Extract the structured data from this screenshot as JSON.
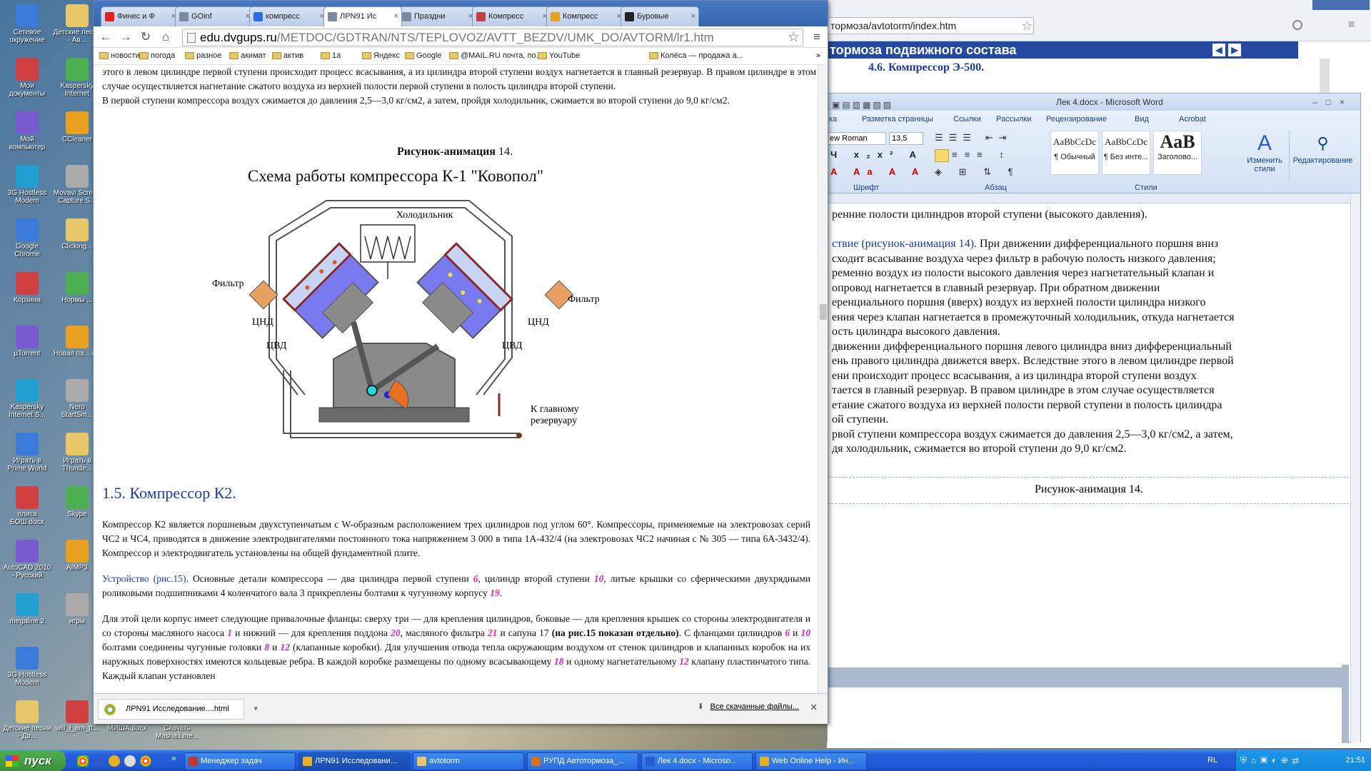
{
  "desktop": {
    "icons": [
      {
        "label": "Сетевое окружение",
        "col": 0,
        "row": 0
      },
      {
        "label": "Детские песни - Ав...",
        "col": 1,
        "row": 0
      },
      {
        "label": "Мои документы",
        "col": 0,
        "row": 1
      },
      {
        "label": "Kaspersky Internet",
        "col": 1,
        "row": 1
      },
      {
        "label": "Мой компьютер",
        "col": 0,
        "row": 2
      },
      {
        "label": "CCleaner",
        "col": 1,
        "row": 2
      },
      {
        "label": "3G Hostless Modem",
        "col": 0,
        "row": 3
      },
      {
        "label": "Movavi Screen Capture S...",
        "col": 1,
        "row": 3
      },
      {
        "label": "Google Chrome",
        "col": 0,
        "row": 4
      },
      {
        "label": "Clicking...",
        "col": 1,
        "row": 4
      },
      {
        "label": "Корзина",
        "col": 0,
        "row": 5
      },
      {
        "label": "Нормы ...",
        "col": 1,
        "row": 5
      },
      {
        "label": "µTorrent",
        "col": 0,
        "row": 6
      },
      {
        "label": "Новая па... (2)",
        "col": 1,
        "row": 6
      },
      {
        "label": "Kaspersky Internet S...",
        "col": 0,
        "row": 7
      },
      {
        "label": "Nero StartSm...",
        "col": 1,
        "row": 7
      },
      {
        "label": "Играть в Prime World",
        "col": 0,
        "row": 8
      },
      {
        "label": "Играть в Thunde...",
        "col": 1,
        "row": 8
      },
      {
        "label": "плита БОШ.docx",
        "col": 0,
        "row": 9
      },
      {
        "label": "Skype",
        "col": 1,
        "row": 9
      },
      {
        "label": "AutoCAD 2010 - Русский",
        "col": 0,
        "row": 10
      },
      {
        "label": "AIMP3",
        "col": 1,
        "row": 10
      },
      {
        "label": "megaline 2",
        "col": 0,
        "row": 11
      },
      {
        "label": "игры",
        "col": 1,
        "row": 11
      },
      {
        "label": "3G Hostless Modem",
        "col": 0,
        "row": 12
      },
      {
        "label": "Детские песни - Дв...",
        "col": 0,
        "row": 13
      },
      {
        "label": "will_i_am_ft...",
        "col": 1,
        "row": 13
      },
      {
        "label": "МИША.docx",
        "col": 2,
        "row": 13
      },
      {
        "label": "Скачать Masha.i.me...",
        "col": 3,
        "row": 13
      }
    ]
  },
  "browser": {
    "tabs": [
      {
        "label": "Финес и Ф",
        "color": "#e02020"
      },
      {
        "label": "GOinf",
        "color": "#7a8aa0"
      },
      {
        "label": "компресс",
        "color": "#2a6de0"
      },
      {
        "label": "ЛРN91 Ис",
        "color": "#7a8aa0",
        "active": true
      },
      {
        "label": "Праздни",
        "color": "#7a8aa0"
      },
      {
        "label": "Компресс",
        "color": "#c04040"
      },
      {
        "label": "Компресс",
        "color": "#e8a020"
      },
      {
        "label": "Буровые",
        "color": "#222222"
      }
    ],
    "url_host": "edu.dvgups.ru",
    "url_path": "/METDOC/GDTRAN/NTS/TEPLOVOZ/AVTT_BEZDV/UMK_DO/AVTORM/lr1.htm",
    "bookmarks": [
      "новости",
      "погода",
      "разное",
      "акимат",
      "актив",
      "1а",
      "Яндекс",
      "Google",
      "@MAIL.RU почта, по...",
      "YouTube",
      "Колёса — продажа а..."
    ],
    "bookmarks_more": "»",
    "content": {
      "para1": "этого в левом цилиндре первой ступени происходит процесс всасывания, а из цилиндра второй ступени воздух нагнетается в главный резервуар. В правом цилиндре в этом случае осуществляется нагнетание сжатого воздуха из верхней полости первой ступени в полость цилиндра второй ступени.",
      "para2": "В первой ступени компрессора воздух сжимается до давления 2,5—3,0 кг/см2, а затем, пройдя холодильник, сжимается во второй ступени до 9,0 кг/см2.",
      "fig_caption_bold": "Рисунок-анимация",
      "fig_caption_num": " 14.",
      "fig_title": "Схема работы компрессора К-1 \"Ковопол\"",
      "labels": {
        "cooler": "Холодильник",
        "filter_left": "Фильтр",
        "filter_right": "Фильтр",
        "cnd_left": "ЦНД",
        "cnd_right": "ЦНД",
        "cvd_left": "ЦВД",
        "cvd_right": "ЦВД",
        "reservoir1": "К главному",
        "reservoir2": "резервуару"
      },
      "heading": "1.5. Компрессор К2.",
      "para3": "Компрессор К2 является поршневым двухступенчатым с W-образным расположением трех цилиндров под углом 60°. Компрессоры, применяемые на электровозах серий ЧС2 и ЧС4, приводятся в движение электродвигателями постоянного тока напряжением 3 000 в типа 1А-432/4 (на электровозах ЧС2 начиная с № 305 — типа 6А-3432/4). Компрессор и электродвигатель установлены на общей фундаментной плите.",
      "para4_lead": "Устройство (рис.15)",
      "para4_a": ". Основные детали компрессора — два цилиндра первой ступени ",
      "n6": "6",
      "para4_b": ", цилиндр второй ступени ",
      "n10": "10",
      "para4_c": ", литые крышки со сферическими двухрядными роликовыми подшипниками 4 коленчатого вала 3 прикреплены болтами к чугунному корпусу ",
      "n19": "19",
      "para4_d": ".",
      "para5_a": "Для этой цели корпус имеет следующие привалочные фланцы: сверху три — для крепления цилиндров, боковые — для крепления крышек со стороны электродвигателя и со стороны масляного насоса ",
      "n1": "1",
      "para5_b": " и нижний — для крепления поддона ",
      "n20": "20",
      "para5_c": ", масляного фильтра ",
      "n21": "21",
      "para5_d": " и сапуна 17 ",
      "para5_bold": "(на рис.15 показан отдельно)",
      "para5_e": ". С фланцами цилиндров ",
      "n6b": "6",
      "para5_f": " и ",
      "n10b": "10",
      "para5_g": " болтами соединены чугунные головки ",
      "n8": "8",
      "para5_h": " и ",
      "n12": "12",
      "para5_i": " (клапанные коробки). Для улучшения отвода тепла окружающим воздухом от стенок цилиндров и клапанных коробок на их наружных поверхностях имеются кольцевые ребра. В каждой коробке размещены по одному всасывающему ",
      "n18": "18",
      "para5_j": " и одному нагнетательному ",
      "n13": "12",
      "para5_k": " клапану пластинчатого типа. Каждый клапан установлен"
    },
    "download": {
      "file": "ЛРN91 Исследование....html",
      "all": "Все скачанные файлы..."
    }
  },
  "right_page": {
    "url": "тормоза/avtotorm/index.htm",
    "header": "тормоза подвижного состава",
    "subheader": "4.6. Компрессор Э-500."
  },
  "word": {
    "title": "Лек 4.docx - Microsoft Word",
    "tabs": [
      "ка",
      "Разметка страницы",
      "Ссылки",
      "Рассылки",
      "Рецензирование",
      "Вид",
      "Acrobat"
    ],
    "font_name": "ew Roman",
    "font_size": "13,5",
    "styles": [
      {
        "sample": "AaBbCcDc",
        "label": "¶ Обычный"
      },
      {
        "sample": "AaBbCcDc",
        "label": "¶ Без инте..."
      },
      {
        "sample": "AaB",
        "label": "Заголово..."
      }
    ],
    "change_styles": "Изменить стили",
    "editing": "Редактирование",
    "groups": [
      "Шрифт",
      "Абзац",
      "Стили"
    ],
    "lines": [
      "ренние полости цилиндров второй ступени (высокого давления).",
      "",
      "ствие (рисунок-анимация 14). При движении дифференциального поршня вниз",
      "сходит всасывание воздуха через фильтр в рабочую полость низкого давления;",
      "ременно воздух из полости высокого давления через нагнетательный клапан и",
      "опровод нагнетается в главный резервуар. При обратном движении",
      "еренциального поршня (вверх) воздух из верхней полости цилиндра низкого",
      "ения через клапан нагнетается в промежуточный холодильник, откуда нагнетается",
      "ость цилиндра высокого давления.",
      "движении дифференциального поршня левого цилиндра вниз дифференциальный",
      "ень правого цилиндра движется вверх. Вследствие этого в левом цилиндре первой",
      "ени происходит процесс всасывания, а из цилиндра второй ступени воздух",
      "тается в главный резервуар. В правом цилиндре в этом случае осуществляется",
      "етание сжатого воздуха из верхней полости первой ступени в полость цилиндра",
      "ой ступени.",
      "рвой ступени компрессора воздух сжимается до давления 2,5—3,0 кг/см2, а затем,",
      "дя холодильник, сжимается во второй ступени до 9,0 кг/см2."
    ],
    "caption": "Рисунок-анимация 14."
  },
  "taskbar": {
    "start": "пуск",
    "quicklaunch_more": "»",
    "buttons": [
      {
        "label": "Менеджер задач",
        "color": "#c0392b"
      },
      {
        "label": "ЛРN91 Исследовани...",
        "color": "#e8b020"
      },
      {
        "label": "avtotorm",
        "color": "#e8c66a"
      },
      {
        "label": "РУПД Автотормоза_...",
        "color": "#d07020"
      },
      {
        "label": "Лек 4.docx - Microso...",
        "color": "#2a5bd0"
      },
      {
        "label": "Web Online Help - Ин...",
        "color": "#e8b020"
      }
    ],
    "lang": "RL",
    "time": "21:51"
  }
}
